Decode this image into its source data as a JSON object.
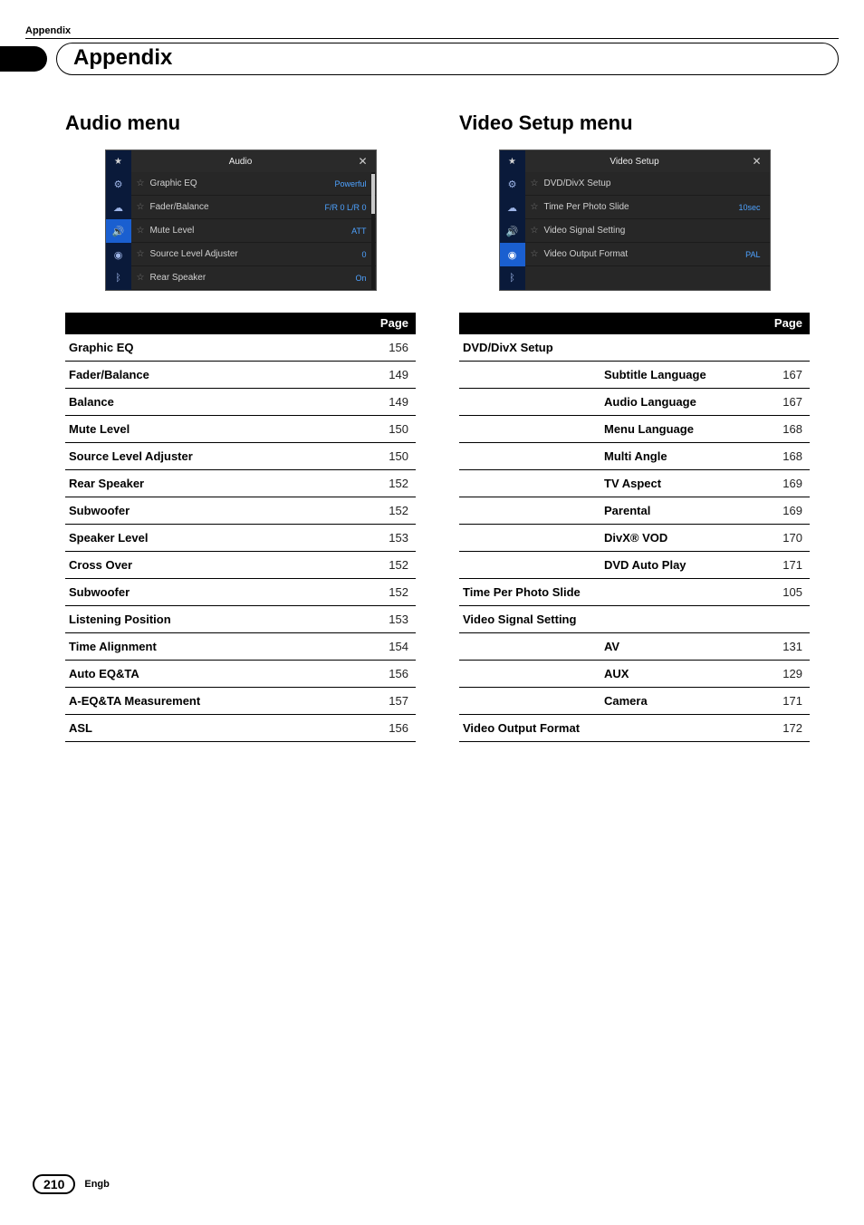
{
  "head": {
    "small": "Appendix",
    "title": "Appendix"
  },
  "footer": {
    "page": "210",
    "lang": "Engb"
  },
  "left": {
    "heading": "Audio menu",
    "device": {
      "title": "Audio",
      "close": "✕",
      "rows": [
        {
          "label": "Graphic EQ",
          "value": "Powerful"
        },
        {
          "label": "Fader/Balance",
          "value": "F/R 0 L/R 0"
        },
        {
          "label": "Mute Level",
          "value": "ATT"
        },
        {
          "label": "Source Level Adjuster",
          "value": "0"
        },
        {
          "label": "Rear Speaker",
          "value": "On"
        }
      ],
      "sidebar_active_index": 2
    },
    "pageHeader": "Page",
    "items": [
      {
        "label": "Graphic EQ",
        "page": "156"
      },
      {
        "label": "Fader/Balance",
        "page": "149"
      },
      {
        "label": "Balance",
        "page": "149"
      },
      {
        "label": "Mute Level",
        "page": "150"
      },
      {
        "label": "Source Level Adjuster",
        "page": "150"
      },
      {
        "label": "Rear Speaker",
        "page": "152"
      },
      {
        "label": "Subwoofer",
        "page": "152"
      },
      {
        "label": "Speaker Level",
        "page": "153"
      },
      {
        "label": "Cross Over",
        "page": "152"
      },
      {
        "label": "Subwoofer",
        "page": "152"
      },
      {
        "label": "Listening Position",
        "page": "153"
      },
      {
        "label": "Time Alignment",
        "page": "154"
      },
      {
        "label": "Auto EQ&TA",
        "page": "156"
      },
      {
        "label": "A-EQ&TA Measurement",
        "page": "157"
      },
      {
        "label": "ASL",
        "page": "156"
      }
    ]
  },
  "right": {
    "heading": "Video Setup menu",
    "device": {
      "title": "Video Setup",
      "close": "✕",
      "rows": [
        {
          "label": "DVD/DivX Setup",
          "value": ""
        },
        {
          "label": "Time Per Photo Slide",
          "value": "10sec"
        },
        {
          "label": "Video Signal Setting",
          "value": ""
        },
        {
          "label": "Video Output Format",
          "value": "PAL"
        }
      ],
      "sidebar_active_index": 3
    },
    "pageHeader": "Page",
    "rows": [
      {
        "type": "group",
        "label": "DVD/DivX Setup"
      },
      {
        "type": "sub",
        "label": "Subtitle Language",
        "page": "167"
      },
      {
        "type": "sub",
        "label": "Audio Language",
        "page": "167"
      },
      {
        "type": "sub",
        "label": "Menu Language",
        "page": "168"
      },
      {
        "type": "sub",
        "label": "Multi Angle",
        "page": "168"
      },
      {
        "type": "sub",
        "label": "TV Aspect",
        "page": "169"
      },
      {
        "type": "sub",
        "label": "Parental",
        "page": "169"
      },
      {
        "type": "sub",
        "label": "DivX® VOD",
        "page": "170"
      },
      {
        "type": "sub",
        "label": "DVD Auto Play",
        "page": "171"
      },
      {
        "type": "item",
        "label": "Time Per Photo Slide",
        "page": "105"
      },
      {
        "type": "group",
        "label": "Video Signal Setting"
      },
      {
        "type": "sub",
        "label": "AV",
        "page": "131"
      },
      {
        "type": "sub",
        "label": "AUX",
        "page": "129"
      },
      {
        "type": "sub",
        "label": "Camera",
        "page": "171"
      },
      {
        "type": "item",
        "label": "Video Output Format",
        "page": "172"
      }
    ]
  },
  "icons": {
    "star": "★",
    "slider": "⚙",
    "palette": "☁",
    "speaker": "🔊",
    "disc": "◉",
    "bt": "ᛒ",
    "outline_star": "☆"
  }
}
